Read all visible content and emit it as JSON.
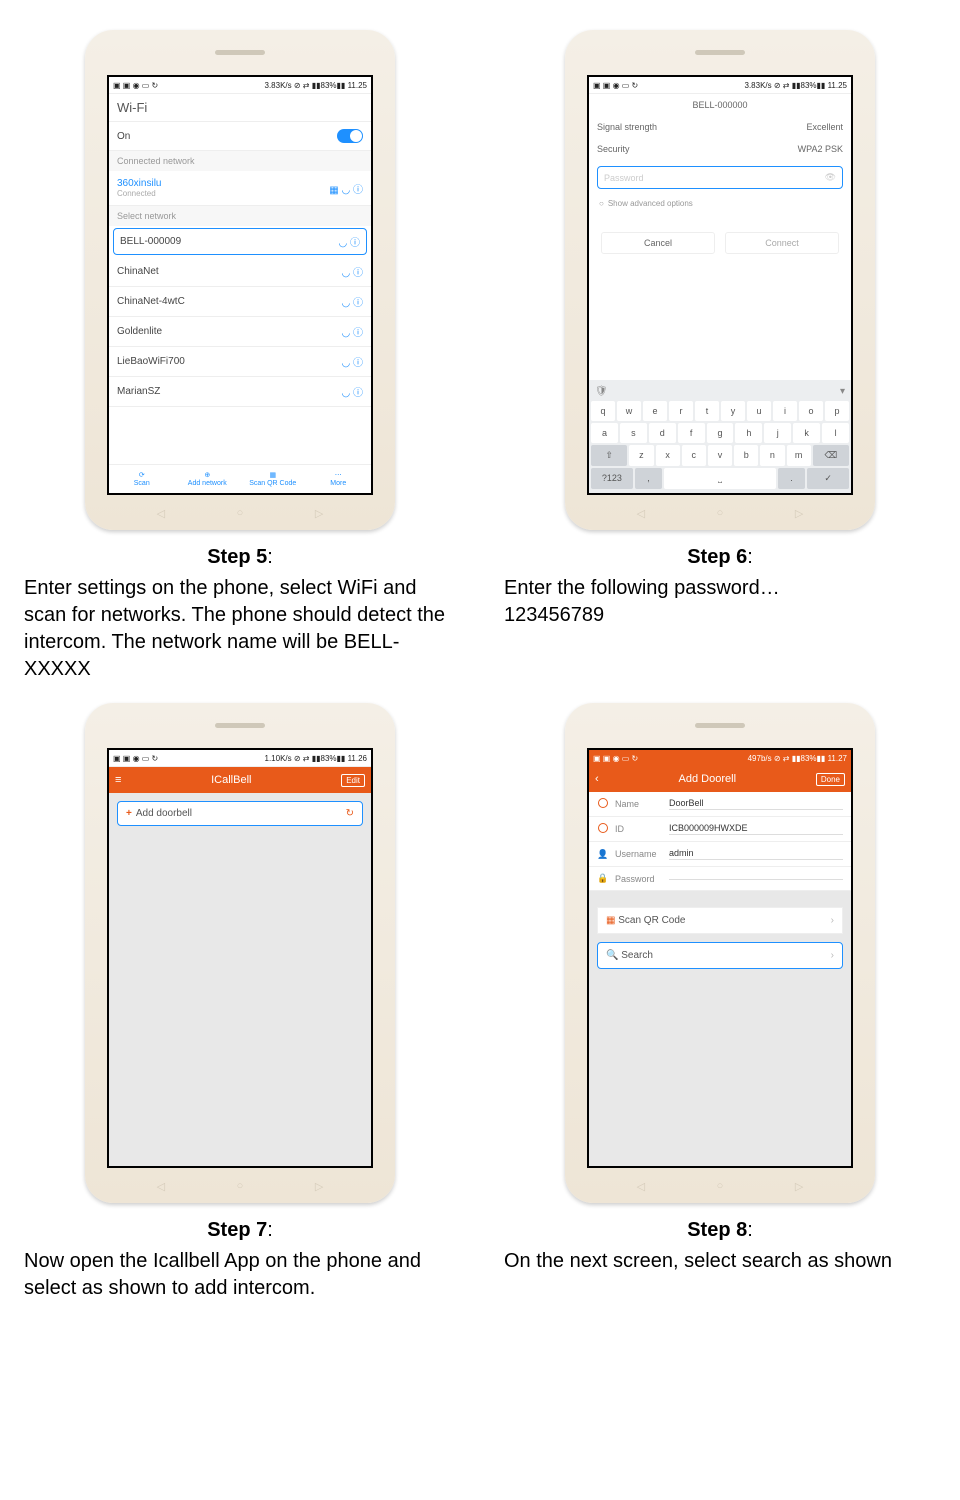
{
  "status_time": "11.25",
  "status_left_icons": "▣ ▣ ◉ ▭ ↻",
  "status_net_a": "3.83K/s ⊘ ⇄ ▮▮83%▮▮",
  "status_net_b": "1.10K/s ⊘ ⇄ ▮▮83%▮▮",
  "status_net_c": "497b/s ⊘ ⇄ ▮▮83%▮▮",
  "status_time_c": "11.26",
  "status_time_d": "11.27",
  "step5": {
    "title_bold": "Step 5",
    "title_colon": ":",
    "desc": "Enter settings on the phone, select WiFi and scan for networks. The phone should detect the intercom. The network name will be BELL-XXXXX",
    "header": "Wi-Fi",
    "on_label": "On",
    "connected_section": "Connected network",
    "connected_name": "360xinsilu",
    "connected_status": "Connected",
    "select_section": "Select network",
    "networks": [
      "BELL-000009",
      "ChinaNet",
      "ChinaNet-4wtC",
      "Goldenlite",
      "LieBaoWiFi700",
      "MarianSZ"
    ],
    "bn1": "Scan",
    "bn2": "Add network",
    "bn3": "Scan QR Code",
    "bn4": "More"
  },
  "step6": {
    "title_bold": "Step 6",
    "title_colon": ":",
    "desc_l1": "Enter the following password…",
    "desc_l2": "123456789",
    "title": "BELL-000000",
    "signal_label": "Signal strength",
    "signal_val": "Excellent",
    "security_label": "Security",
    "security_val": "WPA2 PSK",
    "pw_placeholder": "Password",
    "adv": "Show advanced options",
    "cancel": "Cancel",
    "connect": "Connect",
    "kb_r1": [
      "q",
      "w",
      "e",
      "r",
      "t",
      "y",
      "u",
      "i",
      "o",
      "p"
    ],
    "kb_r2": [
      "a",
      "s",
      "d",
      "f",
      "g",
      "h",
      "j",
      "k",
      "l"
    ],
    "kb_r3_shift": "⇧",
    "kb_r3": [
      "z",
      "x",
      "c",
      "v",
      "b",
      "n",
      "m"
    ],
    "kb_r3_del": "⌫",
    "kb_r4_123": "?123",
    "kb_r4_comma": ",",
    "kb_r4_dot": ".",
    "kb_r4_go": "✓"
  },
  "step7": {
    "title_bold": "Step 7",
    "title_colon": ":",
    "desc": "Now open the Icallbell App on the phone and select as shown to add intercom.",
    "app_title": "ICallBell",
    "edit": "Edit",
    "add_label": "Add doorbell"
  },
  "step8": {
    "title_bold": "Step 8",
    "title_colon": ":",
    "desc": "On the next screen, select search as shown",
    "app_title": "Add Doorell",
    "done": "Done",
    "name_lbl": "Name",
    "name_val": "DoorBell",
    "id_lbl": "ID",
    "id_val": "ICB000009HWXDE",
    "user_lbl": "Username",
    "user_val": "admin",
    "pw_lbl": "Password",
    "pw_val": "",
    "scan_qr": "Scan QR Code",
    "search": "Search"
  }
}
